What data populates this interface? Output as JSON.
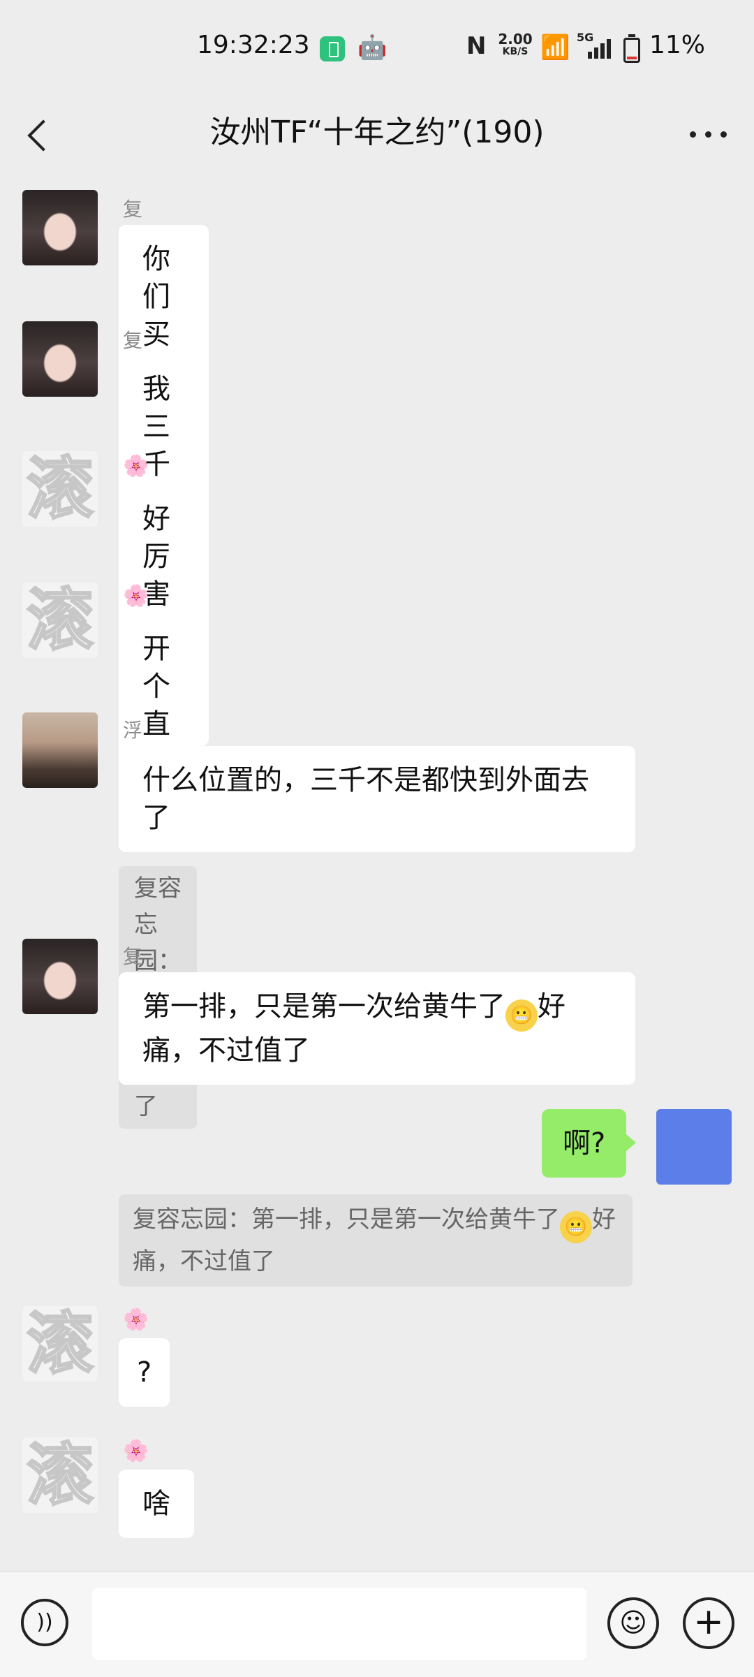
{
  "status_bar": {
    "time": "19:32:23",
    "net_speed_value": "2.00",
    "net_speed_unit": "KB/S",
    "nfc_label": "N",
    "signal_label": "5G",
    "battery_percent": "11%"
  },
  "header": {
    "title": "汝州TF“十年之约”(190)"
  },
  "messages": [
    {
      "sender": "复容忘园",
      "text": "你们买到票的多少钱买到的啊?"
    },
    {
      "sender": "复容忘园",
      "text": "我三千就拿下了"
    },
    {
      "sender": "🌸",
      "text": "好厉害呀"
    },
    {
      "sender": "🌸",
      "text": "开个直播吧"
    },
    {
      "sender": "浮熔游响红",
      "text": "什么位置的，三千不是都快到外面去了",
      "quote": "复容忘园：我三千就拿下了"
    },
    {
      "sender": "复容忘园",
      "text_before": "第一排，只是第一次给黄牛了",
      "text_after": "好痛，不过值了"
    },
    {
      "sender": "me",
      "text": "啊?",
      "quote_before": "复容忘园：第一排，只是第一次给黄牛了",
      "quote_after": "好痛，不过值了"
    },
    {
      "sender": "🌸",
      "text": "?"
    },
    {
      "sender": "🌸",
      "text": "啥"
    }
  ],
  "avatar_glyph": "滚",
  "icons": {
    "back": "chevron-left-icon",
    "more": "more-dots-icon",
    "voice": "voice-icon",
    "emoji": "emoji-icon",
    "plus": "plus-icon",
    "emoji_inline": "grimace-emoji-icon"
  },
  "colors": {
    "background": "#ededed",
    "bubble_other": "#ffffff",
    "bubble_me": "#95ec69",
    "quote_bg": "#e0e0e0",
    "my_avatar": "#5b7ee8"
  }
}
